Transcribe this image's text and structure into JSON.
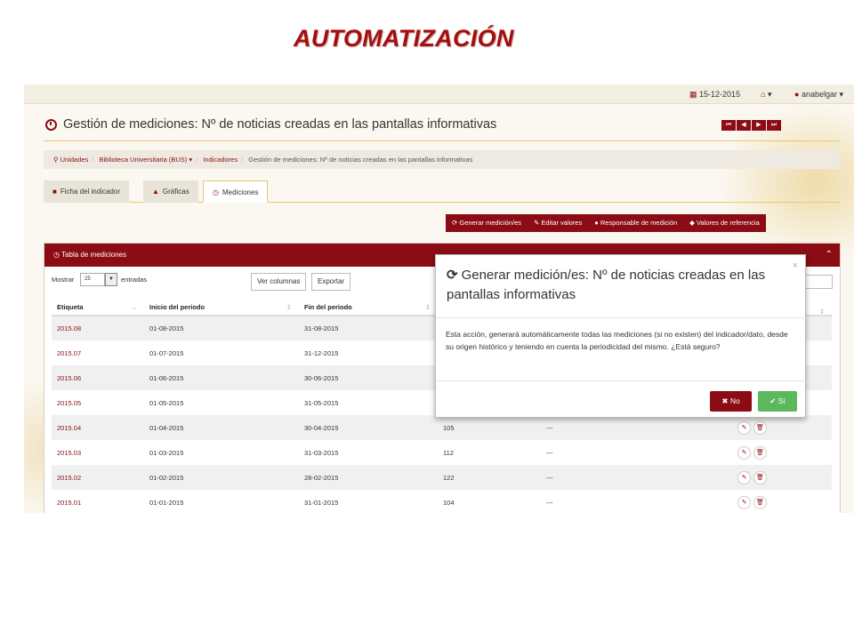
{
  "slide": {
    "title": "AUTOMATIZACIÓN"
  },
  "topbar": {
    "date": "15-12-2015",
    "home_icon": "home-icon",
    "user": "anabelgar"
  },
  "header": {
    "title": "Gestión de mediciones: Nº de noticias creadas en las pantallas informativas",
    "nav_buttons": [
      "⏮",
      "◀",
      "▶",
      "⏭"
    ]
  },
  "breadcrumb": {
    "items": [
      "Unidades",
      "Biblioteca Universitaria (BUS)",
      "Indicadores"
    ],
    "current": "Gestión de mediciones: Nº de noticias creadas en las pantallas informativas"
  },
  "tabs": [
    {
      "label": "Ficha del indicador",
      "icon": "folder-icon"
    },
    {
      "label": "Gráficas",
      "icon": "chart-icon"
    },
    {
      "label": "Mediciones",
      "icon": "clock-icon"
    }
  ],
  "actions": [
    "Generar medición/es",
    "Editar valores",
    "Responsable de medición",
    "Valores de referencia"
  ],
  "panel": {
    "title": "Tabla de mediciones",
    "show_label": "Mostrar",
    "page_size": "25",
    "entries_label": "entradas",
    "columns_button": "Ver columnas",
    "export_button": "Exportar"
  },
  "table": {
    "headers": [
      "Etiqueta",
      "Inicio del periodo",
      "Fin del periodo"
    ],
    "rows": [
      {
        "tag": "2015.08",
        "start": "01-08-2015",
        "end": "31-08-2015",
        "value": "",
        "ref": ""
      },
      {
        "tag": "2015.07",
        "start": "01-07-2015",
        "end": "31-12-2015",
        "value": "",
        "ref": ""
      },
      {
        "tag": "2015.06",
        "start": "01-06-2015",
        "end": "30-06-2015",
        "value": "",
        "ref": ""
      },
      {
        "tag": "2015.05",
        "start": "01-05-2015",
        "end": "31-05-2015",
        "value": "",
        "ref": ""
      },
      {
        "tag": "2015.04",
        "start": "01-04-2015",
        "end": "30-04-2015",
        "value": "105",
        "ref": "---"
      },
      {
        "tag": "2015.03",
        "start": "01-03-2015",
        "end": "31-03-2015",
        "value": "112",
        "ref": "---"
      },
      {
        "tag": "2015.02",
        "start": "01-02-2015",
        "end": "28-02-2015",
        "value": "122",
        "ref": "---"
      },
      {
        "tag": "2015.01",
        "start": "01-01-2015",
        "end": "31-01-2015",
        "value": "104",
        "ref": "---"
      }
    ]
  },
  "modal": {
    "title": "Generar medición/es: Nº de noticias creadas en las pantallas informativas",
    "body": "Esta acción, generará automáticamente todas las mediciones (si no existen) del indicador/dato, desde su origen histórico y teniendo en cuenta la periodicidad del mismo. ¿Está seguro?",
    "no_label": "No",
    "yes_label": "Sí"
  }
}
